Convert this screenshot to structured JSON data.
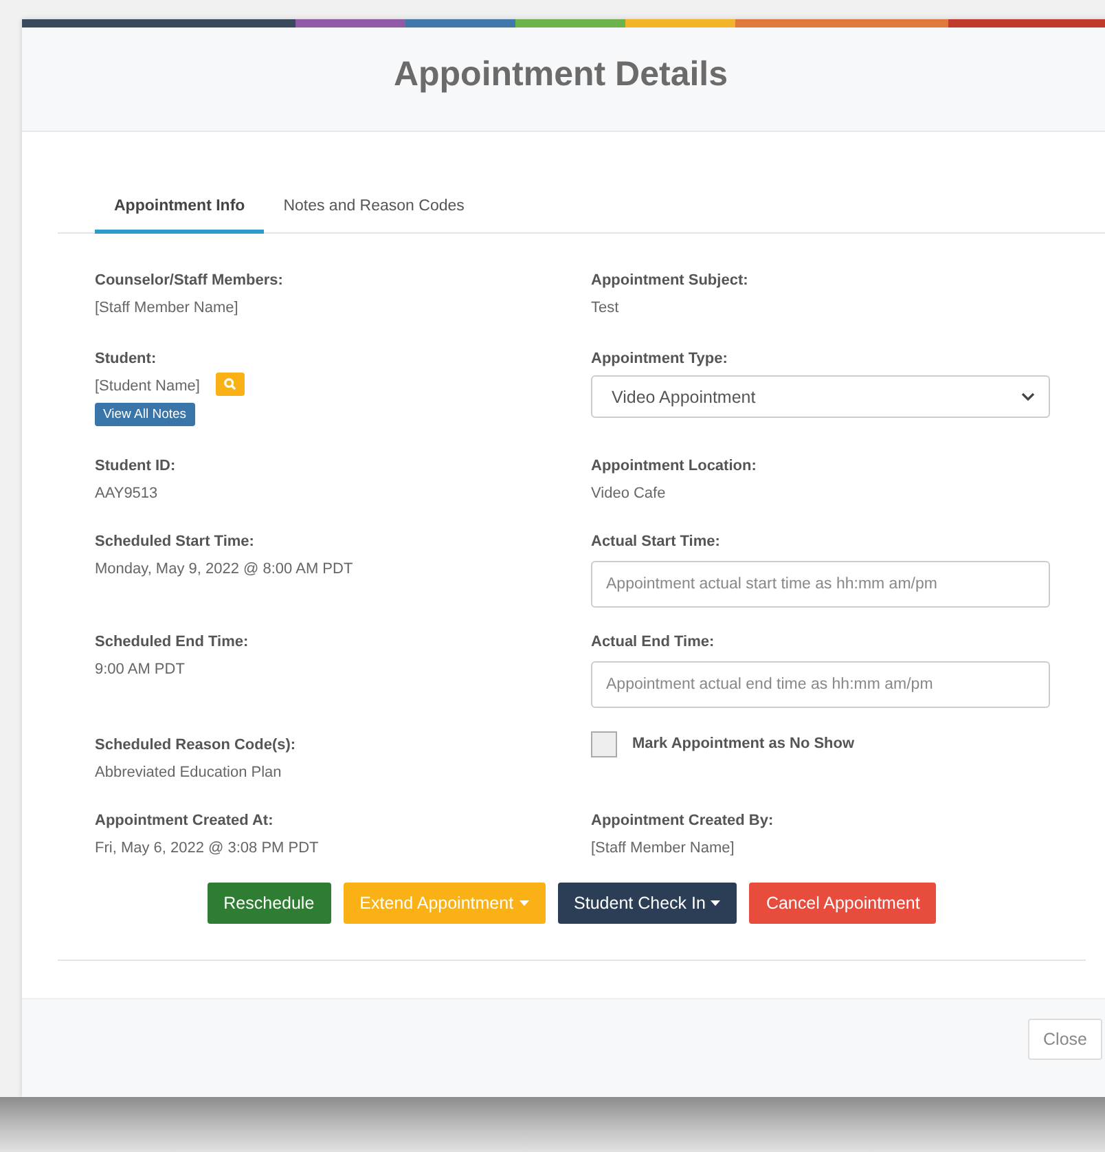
{
  "dialog": {
    "title": "Appointment Details"
  },
  "tabs": [
    {
      "label": "Appointment Info",
      "selected": true
    },
    {
      "label": "Notes and Reason Codes",
      "selected": false
    }
  ],
  "rows": [
    {
      "left": {
        "kind": "text",
        "label": "Counselor/Staff Members:",
        "value": "[Staff Member Name]"
      },
      "right": {
        "kind": "text",
        "label": "Appointment Subject:",
        "value": "Test"
      }
    },
    {
      "left": {
        "kind": "student",
        "label": "Student:",
        "value": "[Student Name]",
        "notes_button": "View All Notes"
      },
      "right": {
        "kind": "select",
        "label": "Appointment Type:",
        "value": "Video Appointment"
      }
    },
    {
      "left": {
        "kind": "text",
        "label": "Student ID:",
        "value": "AAY9513"
      },
      "right": {
        "kind": "text",
        "label": "Appointment Location:",
        "value": "Video Cafe"
      }
    },
    {
      "left": {
        "kind": "text",
        "label": "Scheduled Start Time:",
        "value": "Monday, May 9, 2022 @ 8:00 AM PDT"
      },
      "right": {
        "kind": "input",
        "label": "Actual Start Time:",
        "placeholder": "Appointment actual start time as hh:mm am/pm"
      }
    },
    {
      "left": {
        "kind": "text",
        "label": "Scheduled End Time:",
        "value": "9:00 AM PDT"
      },
      "right": {
        "kind": "input",
        "label": "Actual End Time:",
        "placeholder": "Appointment actual end time as hh:mm am/pm"
      }
    },
    {
      "left": {
        "kind": "text",
        "label": "Scheduled Reason Code(s):",
        "value": "Abbreviated Education Plan"
      },
      "right": {
        "kind": "checkbox",
        "label": "Mark Appointment as No Show",
        "checked": false
      }
    },
    {
      "left": {
        "kind": "text",
        "label": "Appointment Created At:",
        "value": "Fri, May 6, 2022 @ 3:08 PM PDT"
      },
      "right": {
        "kind": "text",
        "label": "Appointment Created By:",
        "value": "[Staff Member Name]"
      }
    }
  ],
  "actions": [
    {
      "label": "Reschedule",
      "color": "#2e7d32",
      "dropdown": false
    },
    {
      "label": "Extend Appointment",
      "color": "#f9b115",
      "dropdown": true
    },
    {
      "label": "Student Check In",
      "color": "#2c3e55",
      "dropdown": true
    },
    {
      "label": "Cancel Appointment",
      "color": "#e74c3c",
      "dropdown": false
    }
  ],
  "footer": {
    "close_button": "Close"
  }
}
